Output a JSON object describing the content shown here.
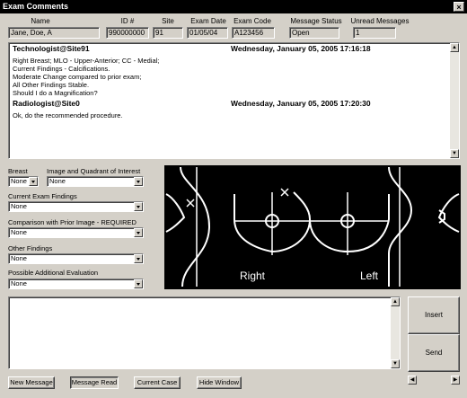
{
  "window": {
    "title": "Exam Comments",
    "close_symbol": "×"
  },
  "header": {
    "columns": [
      {
        "label": "Name",
        "value": "Jane, Doe, A"
      },
      {
        "label": "ID #",
        "value": "990000000"
      },
      {
        "label": "Site",
        "value": "91"
      },
      {
        "label": "Exam Date",
        "value": "01/05/04"
      },
      {
        "label": "Exam Code",
        "value": "A123456"
      },
      {
        "label": "Message Status",
        "value": "Open"
      },
      {
        "label": "Unread Messages",
        "value": "1"
      }
    ]
  },
  "messages": [
    {
      "sender": "Technologist@Site91",
      "timestamp": "Wednesday, January 05, 2005 17:16:18",
      "body": "Right Breast;  MLO - Upper-Anterior;  CC - Medial;\nCurrent Findings - Calcifications.\nModerate Change compared to prior exam;\nAll Other Findings Stable.\nShould I do a Magnification?"
    },
    {
      "sender": "Radiologist@Site0",
      "timestamp": "Wednesday, January 05, 2005 17:20:30",
      "body": "Ok, do the recommended procedure."
    }
  ],
  "form": {
    "breast": {
      "label": "Breast",
      "value": "None"
    },
    "quadrant": {
      "label": "Image and Quadrant of Interest",
      "value": "None"
    },
    "current_findings": {
      "label": "Current Exam Findings",
      "value": "None"
    },
    "comparison": {
      "label": "Comparison with Prior Image - REQUIRED",
      "value": "None"
    },
    "other_findings": {
      "label": "Other Findings",
      "value": "None"
    },
    "additional_eval": {
      "label": "Possible Additional Evaluation",
      "value": "None"
    }
  },
  "diagram": {
    "right_label": "Right",
    "left_label": "Left"
  },
  "actions": {
    "insert": "Insert",
    "send": "Send",
    "new_message": "New Message",
    "message_read": "Message Read",
    "current_case": "Current Case",
    "hide_window": "Hide Window"
  },
  "colors": {
    "titlebar": "#000000",
    "window_bg": "#d4d0c8",
    "diagram_bg": "#000000",
    "diagram_stroke": "#ffffff"
  }
}
